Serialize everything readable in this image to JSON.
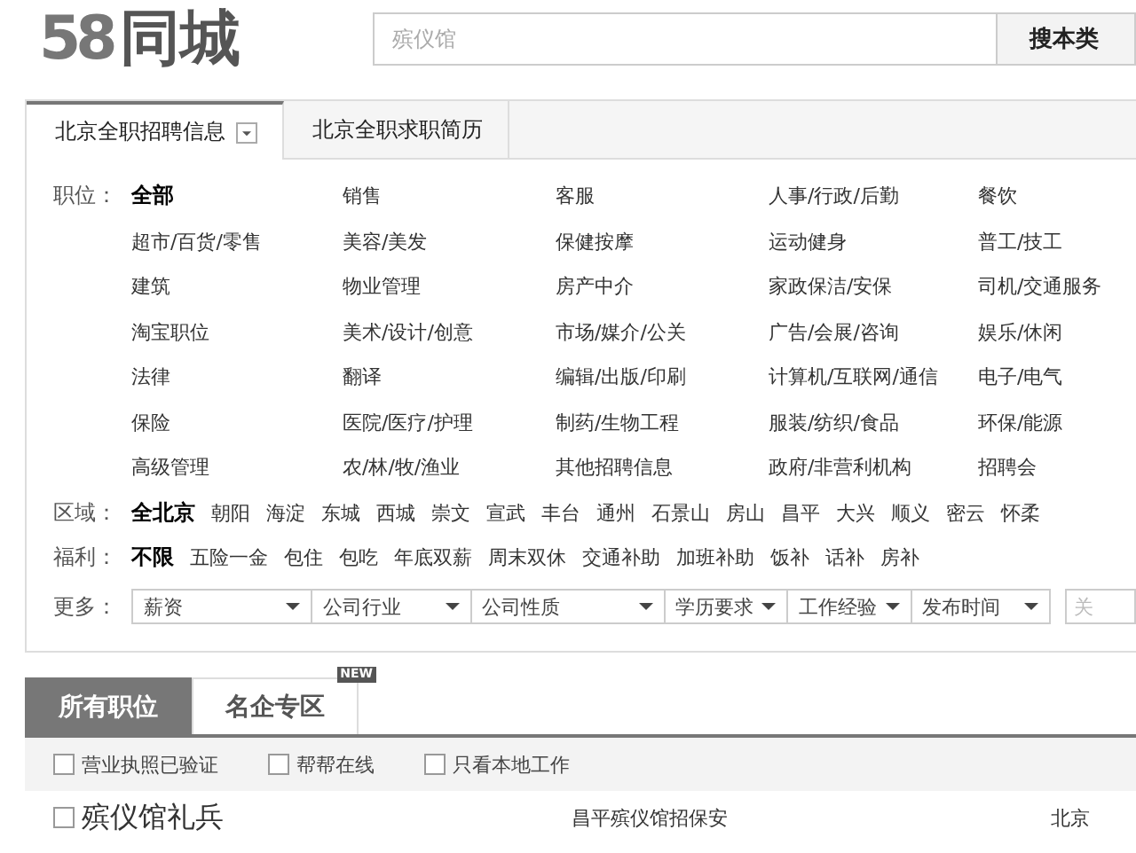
{
  "header": {
    "logo_number": "58",
    "logo_text": "同城",
    "search": {
      "placeholder": "殡仪馆",
      "button": "搜本类"
    }
  },
  "filter_tabs": [
    {
      "label": "北京全职招聘信息",
      "selected": true,
      "dropdown": true
    },
    {
      "label": "北京全职求职简历",
      "selected": false,
      "dropdown": false
    }
  ],
  "position_filter": {
    "label": "职位：",
    "options": [
      {
        "label": "全部",
        "selected": true
      },
      {
        "label": "销售",
        "selected": false
      },
      {
        "label": "客服",
        "selected": false
      },
      {
        "label": "人事/行政/后勤",
        "selected": false
      },
      {
        "label": "餐饮",
        "selected": false
      },
      {
        "label": "超市/百货/零售",
        "selected": false
      },
      {
        "label": "美容/美发",
        "selected": false
      },
      {
        "label": "保健按摩",
        "selected": false
      },
      {
        "label": "运动健身",
        "selected": false
      },
      {
        "label": "普工/技工",
        "selected": false
      },
      {
        "label": "建筑",
        "selected": false
      },
      {
        "label": "物业管理",
        "selected": false
      },
      {
        "label": "房产中介",
        "selected": false
      },
      {
        "label": "家政保洁/安保",
        "selected": false
      },
      {
        "label": "司机/交通服务",
        "selected": false
      },
      {
        "label": "淘宝职位",
        "selected": false
      },
      {
        "label": "美术/设计/创意",
        "selected": false
      },
      {
        "label": "市场/媒介/公关",
        "selected": false
      },
      {
        "label": "广告/会展/咨询",
        "selected": false
      },
      {
        "label": "娱乐/休闲",
        "selected": false
      },
      {
        "label": "法律",
        "selected": false
      },
      {
        "label": "翻译",
        "selected": false
      },
      {
        "label": "编辑/出版/印刷",
        "selected": false
      },
      {
        "label": "计算机/互联网/通信",
        "selected": false
      },
      {
        "label": "电子/电气",
        "selected": false
      },
      {
        "label": "保险",
        "selected": false
      },
      {
        "label": "医院/医疗/护理",
        "selected": false
      },
      {
        "label": "制药/生物工程",
        "selected": false
      },
      {
        "label": "服装/纺织/食品",
        "selected": false
      },
      {
        "label": "环保/能源",
        "selected": false
      },
      {
        "label": "高级管理",
        "selected": false
      },
      {
        "label": "农/林/牧/渔业",
        "selected": false
      },
      {
        "label": "其他招聘信息",
        "selected": false
      },
      {
        "label": "政府/非营利机构",
        "selected": false
      },
      {
        "label": "招聘会",
        "selected": false
      }
    ]
  },
  "region_filter": {
    "label": "区域：",
    "options": [
      {
        "label": "全北京",
        "selected": true
      },
      {
        "label": "朝阳",
        "selected": false
      },
      {
        "label": "海淀",
        "selected": false
      },
      {
        "label": "东城",
        "selected": false
      },
      {
        "label": "西城",
        "selected": false
      },
      {
        "label": "崇文",
        "selected": false
      },
      {
        "label": "宣武",
        "selected": false
      },
      {
        "label": "丰台",
        "selected": false
      },
      {
        "label": "通州",
        "selected": false
      },
      {
        "label": "石景山",
        "selected": false
      },
      {
        "label": "房山",
        "selected": false
      },
      {
        "label": "昌平",
        "selected": false
      },
      {
        "label": "大兴",
        "selected": false
      },
      {
        "label": "顺义",
        "selected": false
      },
      {
        "label": "密云",
        "selected": false
      },
      {
        "label": "怀柔",
        "selected": false
      }
    ]
  },
  "benefit_filter": {
    "label": "福利：",
    "options": [
      {
        "label": "不限",
        "selected": true
      },
      {
        "label": "五险一金",
        "selected": false
      },
      {
        "label": "包住",
        "selected": false
      },
      {
        "label": "包吃",
        "selected": false
      },
      {
        "label": "年底双薪",
        "selected": false
      },
      {
        "label": "周末双休",
        "selected": false
      },
      {
        "label": "交通补助",
        "selected": false
      },
      {
        "label": "加班补助",
        "selected": false
      },
      {
        "label": "饭补",
        "selected": false
      },
      {
        "label": "话补",
        "selected": false
      },
      {
        "label": "房补",
        "selected": false
      }
    ]
  },
  "more_filter": {
    "label": "更多：",
    "dropdowns": [
      "薪资",
      "公司行业",
      "公司性质",
      "学历要求",
      "工作经验",
      "发布时间"
    ],
    "keyword": {
      "placeholder": "关"
    }
  },
  "list_tabs": [
    {
      "label": "所有职位",
      "selected": true
    },
    {
      "label": "名企专区",
      "selected": false,
      "badge": "NEW"
    }
  ],
  "list_filters": [
    {
      "label": "营业执照已验证",
      "checked": false
    },
    {
      "label": "帮帮在线",
      "checked": false
    },
    {
      "label": "只看本地工作",
      "checked": false
    }
  ],
  "listings": [
    {
      "title": "殡仪馆礼兵",
      "checked": false,
      "company": "昌平殡仪馆招保安",
      "location": "北京"
    }
  ]
}
